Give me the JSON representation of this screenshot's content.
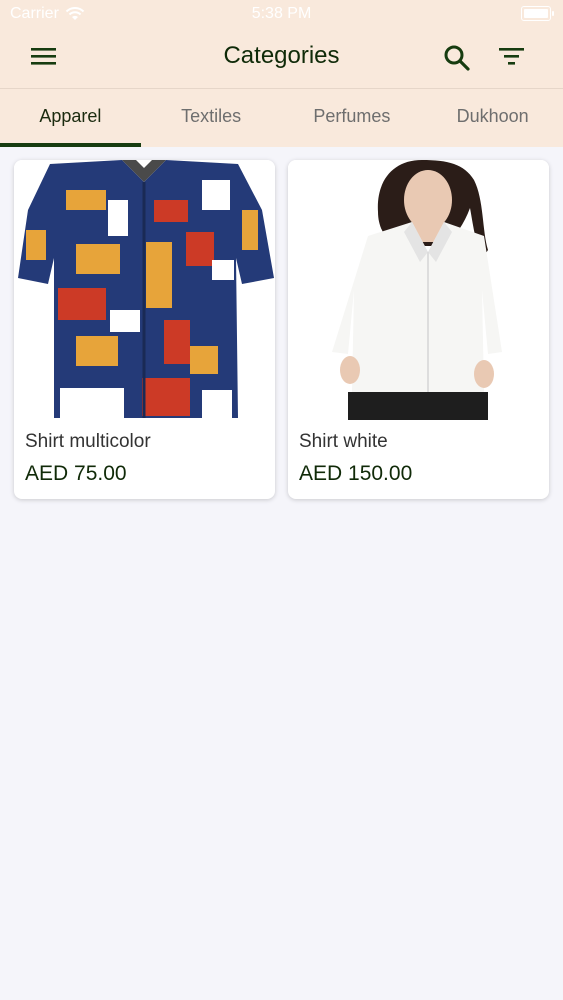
{
  "status_bar": {
    "carrier": "Carrier",
    "time": "5:38 PM"
  },
  "header": {
    "title": "Categories"
  },
  "icons": {
    "menu": "menu-icon",
    "search": "search-icon",
    "filter": "filter-icon"
  },
  "tabs": [
    {
      "label": "Apparel",
      "active": true
    },
    {
      "label": "Textiles",
      "active": false
    },
    {
      "label": "Perfumes",
      "active": false
    },
    {
      "label": "Dukhoon",
      "active": false
    }
  ],
  "products": [
    {
      "name": "Shirt multicolor",
      "price": "AED 75.00"
    },
    {
      "name": "Shirt white",
      "price": "AED 150.00"
    }
  ],
  "colors": {
    "accent": "#173c10",
    "header_bg": "#f9e9dc",
    "page_bg": "#f5f5fa"
  }
}
